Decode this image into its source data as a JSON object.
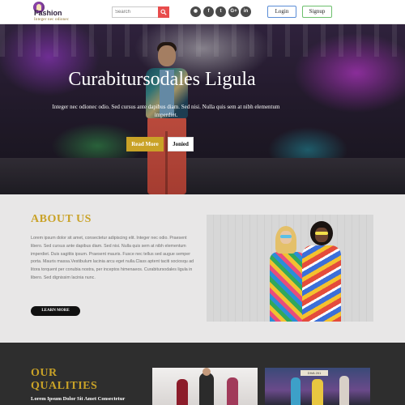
{
  "header": {
    "logo": {
      "title": "Fashion",
      "tagline": "Integer nec odionec"
    },
    "search": {
      "placeholder": "Search",
      "icon": "search-icon"
    },
    "social": [
      {
        "icon": "rss-icon",
        "glyph": "◉"
      },
      {
        "icon": "facebook-icon",
        "glyph": "f"
      },
      {
        "icon": "twitter-icon",
        "glyph": "t"
      },
      {
        "icon": "google-plus-icon",
        "glyph": "G+"
      },
      {
        "icon": "linkedin-icon",
        "glyph": "in"
      }
    ],
    "login_label": "Login",
    "signup_label": "Signup"
  },
  "hero": {
    "title": "Curabitursodales Ligula",
    "subtitle": "Integer nec odionec odio. Sed cursus ante dapibus diam. Sed nisi. Nulla quis sem at nibh elementum imperdiet.",
    "read_more_label": "Read More",
    "joined_label": "Jonied"
  },
  "about": {
    "title": "ABOUT US",
    "text": "Lorem ipsum dolor sit amet, consectetur adipiscing elit. Integer nec odio. Praesent libero. Sed cursus ante dapibus diam. Sed nisi. Nulla quis sem at nibh elementum imperdiet. Duis sagittis ipsum. Praesent mauris. Fusce nec tellus sed augue semper porta. Mauris massa.Vestibulum lacinia arcu eget nulla.Class aptent taciti sociosqu ad litora torquent per conubia nostra, per inceptos himenaeos. Curabitursodales ligula in libero. Sed dignissim lacinia nunc.",
    "learn_more_label": "LEARN MORE"
  },
  "qualities": {
    "title_line1": "OUR",
    "title_line2": "QUALITIES",
    "subtitle": "Lorem Ipsum Dolor Sit Amet Consectetur",
    "banner_text": "DIVA 201"
  },
  "colors": {
    "accent_gold": "#c9a227",
    "search_red": "#e84c4c",
    "login_border": "#5b8dd6",
    "signup_border": "#6cbf6c",
    "dark_section": "#2e2e2e",
    "about_bg": "#e8e7e7"
  }
}
